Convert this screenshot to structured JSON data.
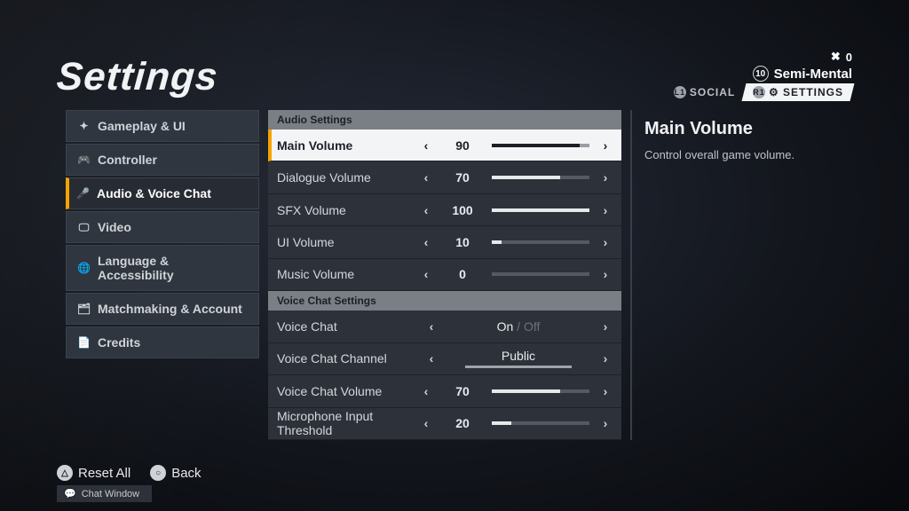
{
  "title": "Settings",
  "hud": {
    "currency_icon": "✖",
    "currency_value": "0",
    "level": "10",
    "username": "Semi-Mental",
    "social_prompt": "L1",
    "social_label": "SOCIAL",
    "settings_prompt": "R1",
    "settings_label": "SETTINGS"
  },
  "sidebar": [
    {
      "icon": "✦",
      "label": "Gameplay & UI"
    },
    {
      "icon": "🎮",
      "label": "Controller"
    },
    {
      "icon": "🎤",
      "label": "Audio & Voice Chat",
      "active": true
    },
    {
      "icon": "🖵",
      "label": "Video"
    },
    {
      "icon": "🌐",
      "label": "Language & Accessibility"
    },
    {
      "icon": "🗂",
      "label": "Matchmaking & Account"
    },
    {
      "icon": "📄",
      "label": "Credits"
    }
  ],
  "groups": {
    "audio_header": "Audio Settings",
    "voice_header": "Voice Chat Settings"
  },
  "rows": {
    "main_volume": {
      "label": "Main Volume",
      "value": 90,
      "max": 100,
      "selected": true
    },
    "dialogue_volume": {
      "label": "Dialogue Volume",
      "value": 70,
      "max": 100
    },
    "sfx_volume": {
      "label": "SFX Volume",
      "value": 100,
      "max": 100
    },
    "ui_volume": {
      "label": "UI Volume",
      "value": 10,
      "max": 100
    },
    "music_volume": {
      "label": "Music Volume",
      "value": 0,
      "max": 100
    },
    "voice_chat": {
      "label": "Voice Chat",
      "option_on": "On",
      "option_off": "Off",
      "sep": " / "
    },
    "voice_channel": {
      "label": "Voice Chat Channel",
      "option": "Public"
    },
    "voice_volume": {
      "label": "Voice Chat Volume",
      "value": 70,
      "max": 100
    },
    "mic_threshold": {
      "label": "Microphone Input Threshold",
      "value": 20,
      "max": 100
    }
  },
  "desc": {
    "title": "Main Volume",
    "body": "Control overall game volume."
  },
  "footer": {
    "reset_glyph": "△",
    "reset_label": "Reset All",
    "back_glyph": "○",
    "back_label": "Back",
    "chat_icon": "💬",
    "chat_label": "Chat Window"
  }
}
